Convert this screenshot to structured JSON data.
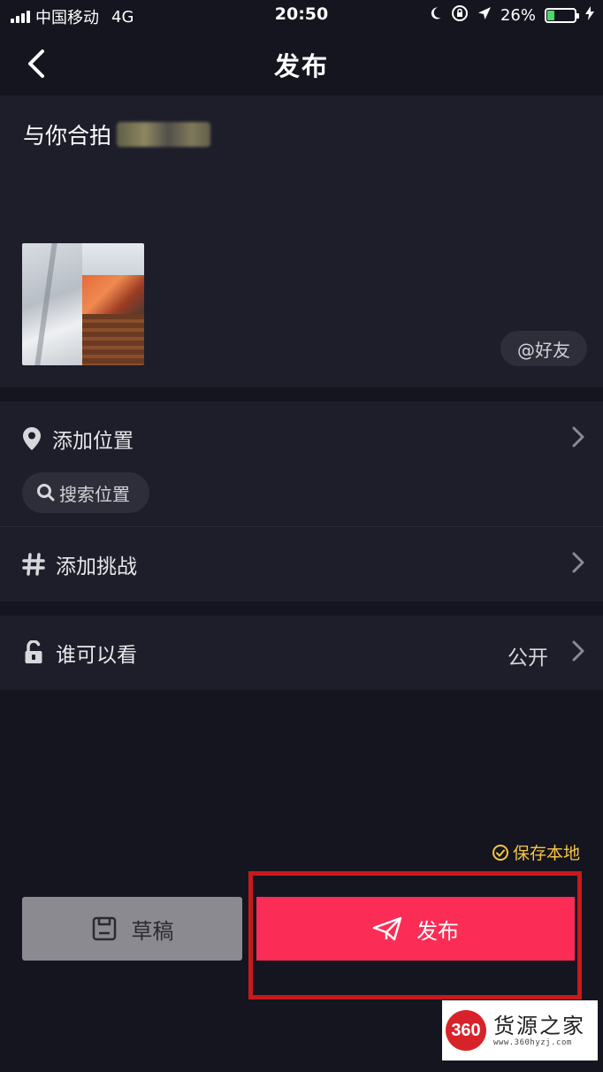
{
  "status_bar": {
    "carrier": "中国移动",
    "network": "4G",
    "time": "20:50",
    "battery_percent": "26%",
    "battery_level": 0.26
  },
  "nav": {
    "title": "发布"
  },
  "description": {
    "text": "与你合拍",
    "at_symbol": "@"
  },
  "friend_button": {
    "label": "@好友"
  },
  "location": {
    "label": "添加位置",
    "search_label": "搜索位置"
  },
  "challenge": {
    "label": "添加挑战"
  },
  "visibility": {
    "label": "谁可以看",
    "value": "公开"
  },
  "save_local": {
    "label": "保存本地"
  },
  "actions": {
    "draft_label": "草稿",
    "publish_label": "发布"
  },
  "watermark": {
    "logo": "360",
    "title": "货源之家",
    "url": "www.360hyzj.com"
  },
  "colors": {
    "background": "#151520",
    "card": "#1e1e2a",
    "publish": "#fb2c55",
    "draft": "#8a8a90",
    "save_local": "#f5c542",
    "highlight": "#c81a1a"
  }
}
